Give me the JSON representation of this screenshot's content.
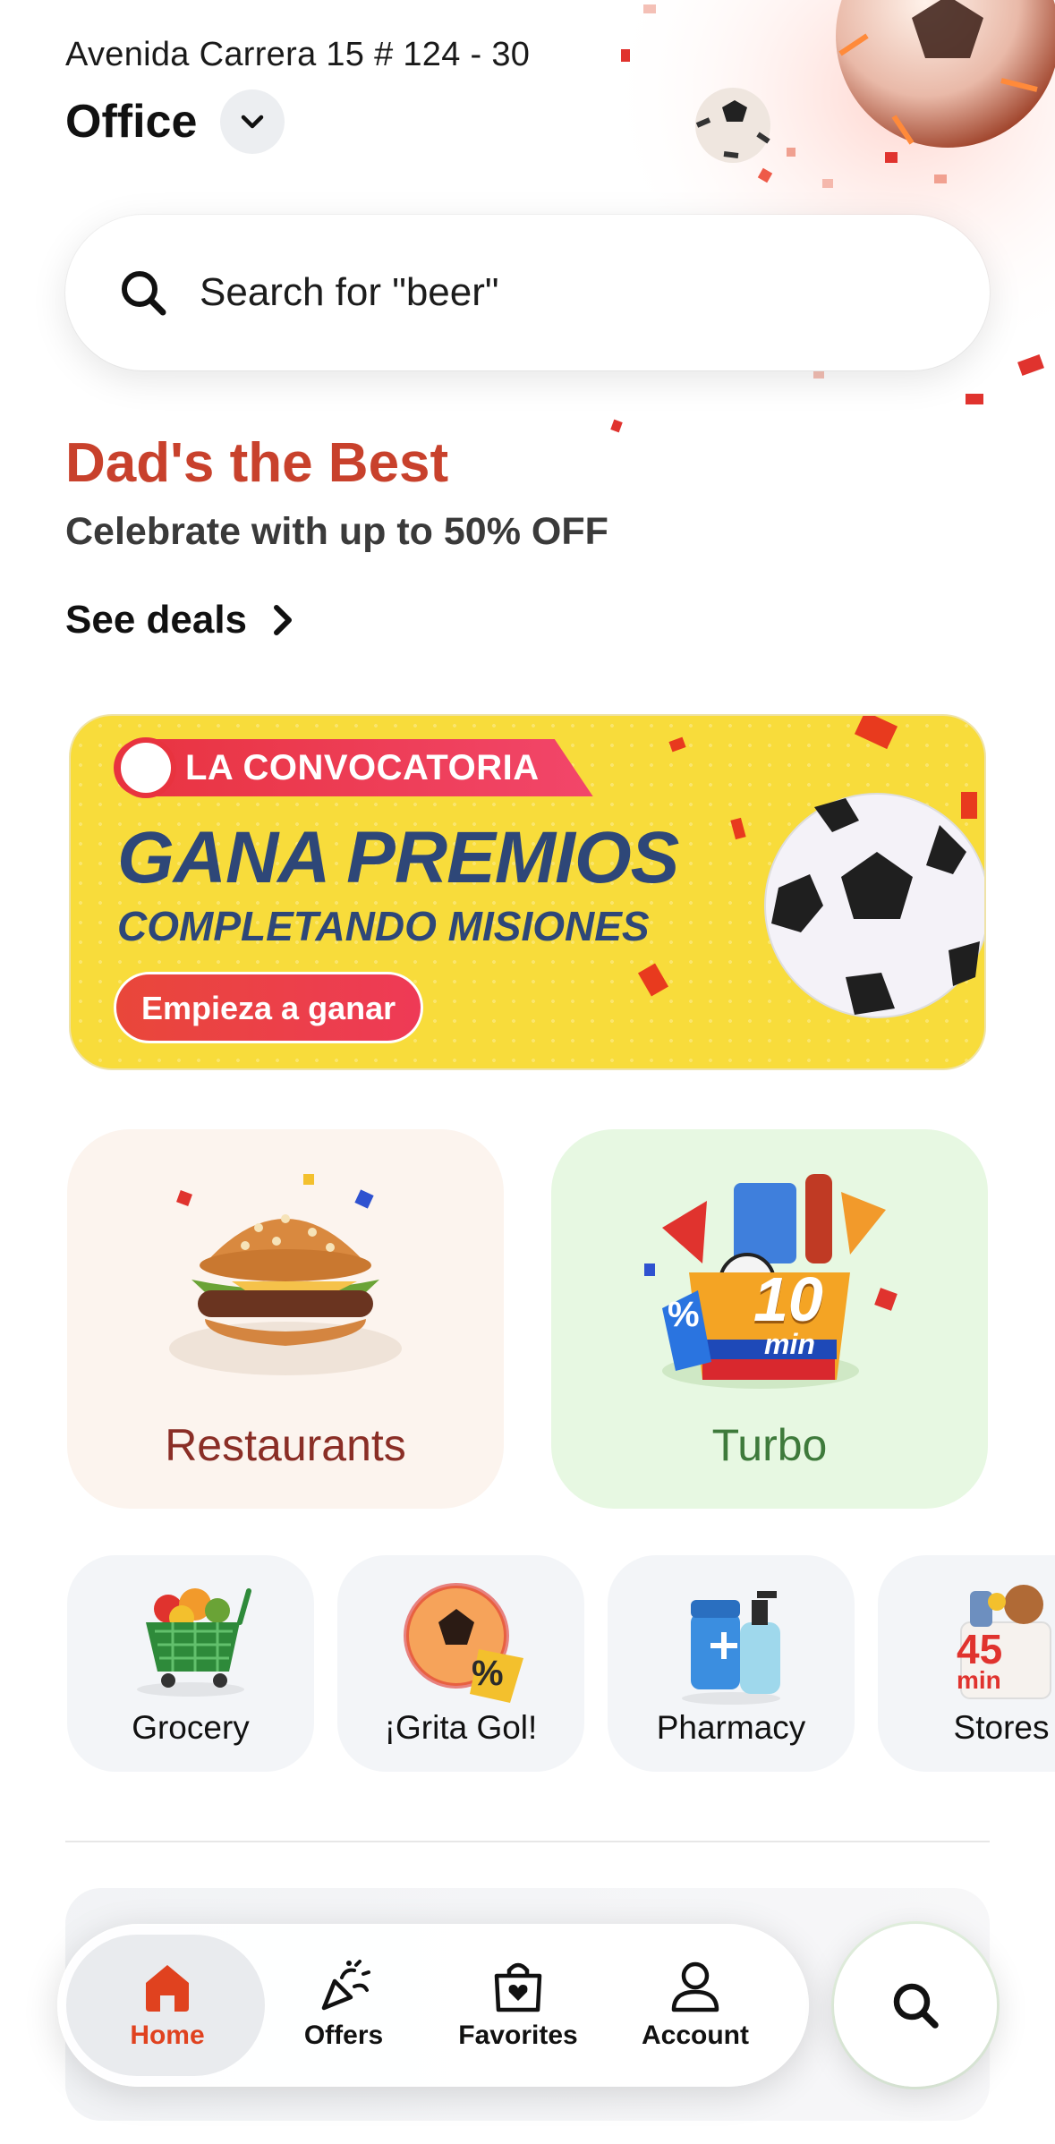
{
  "header": {
    "address": "Avenida Carrera 15 # 124 - 30",
    "location_name": "Office",
    "dropdown_icon": "chevron-down-icon"
  },
  "search": {
    "placeholder": "Search for \"beer\"",
    "icon": "search-icon"
  },
  "promo": {
    "title": "Dad's the Best",
    "subtitle": "Celebrate with up to 50% OFF",
    "link_label": "See deals",
    "title_color": "#c8412c"
  },
  "banner": {
    "tag": "LA CONVOCATORIA",
    "title": "GANA PREMIOS",
    "subtitle": "COMPLETANDO MISIONES",
    "cta_label": "Empieza a ganar",
    "background_color": "#f8dc3b"
  },
  "categories": [
    {
      "label": "Restaurants",
      "icon": "burger-icon"
    },
    {
      "label": "Turbo",
      "icon": "turbo-box-icon",
      "badge_number": "10",
      "badge_unit": "min",
      "badge_symbol": "%"
    }
  ],
  "subcategories": [
    {
      "label": "Grocery",
      "icon": "grocery-cart-icon"
    },
    {
      "label": "¡Grita Gol!",
      "icon": "soccer-ball-icon",
      "badge_symbol": "%"
    },
    {
      "label": "Pharmacy",
      "icon": "pharmacy-icon"
    },
    {
      "label": "Stores",
      "icon": "shopping-bag-icon",
      "badge_number": "45",
      "badge_unit": "min"
    }
  ],
  "nav": {
    "active": "Home",
    "accent_color": "#e0421f",
    "items": [
      {
        "label": "Home",
        "icon": "home-icon"
      },
      {
        "label": "Offers",
        "icon": "party-popper-icon"
      },
      {
        "label": "Favorites",
        "icon": "heart-bag-icon"
      },
      {
        "label": "Account",
        "icon": "user-icon"
      }
    ],
    "fab_icon": "search-icon"
  }
}
